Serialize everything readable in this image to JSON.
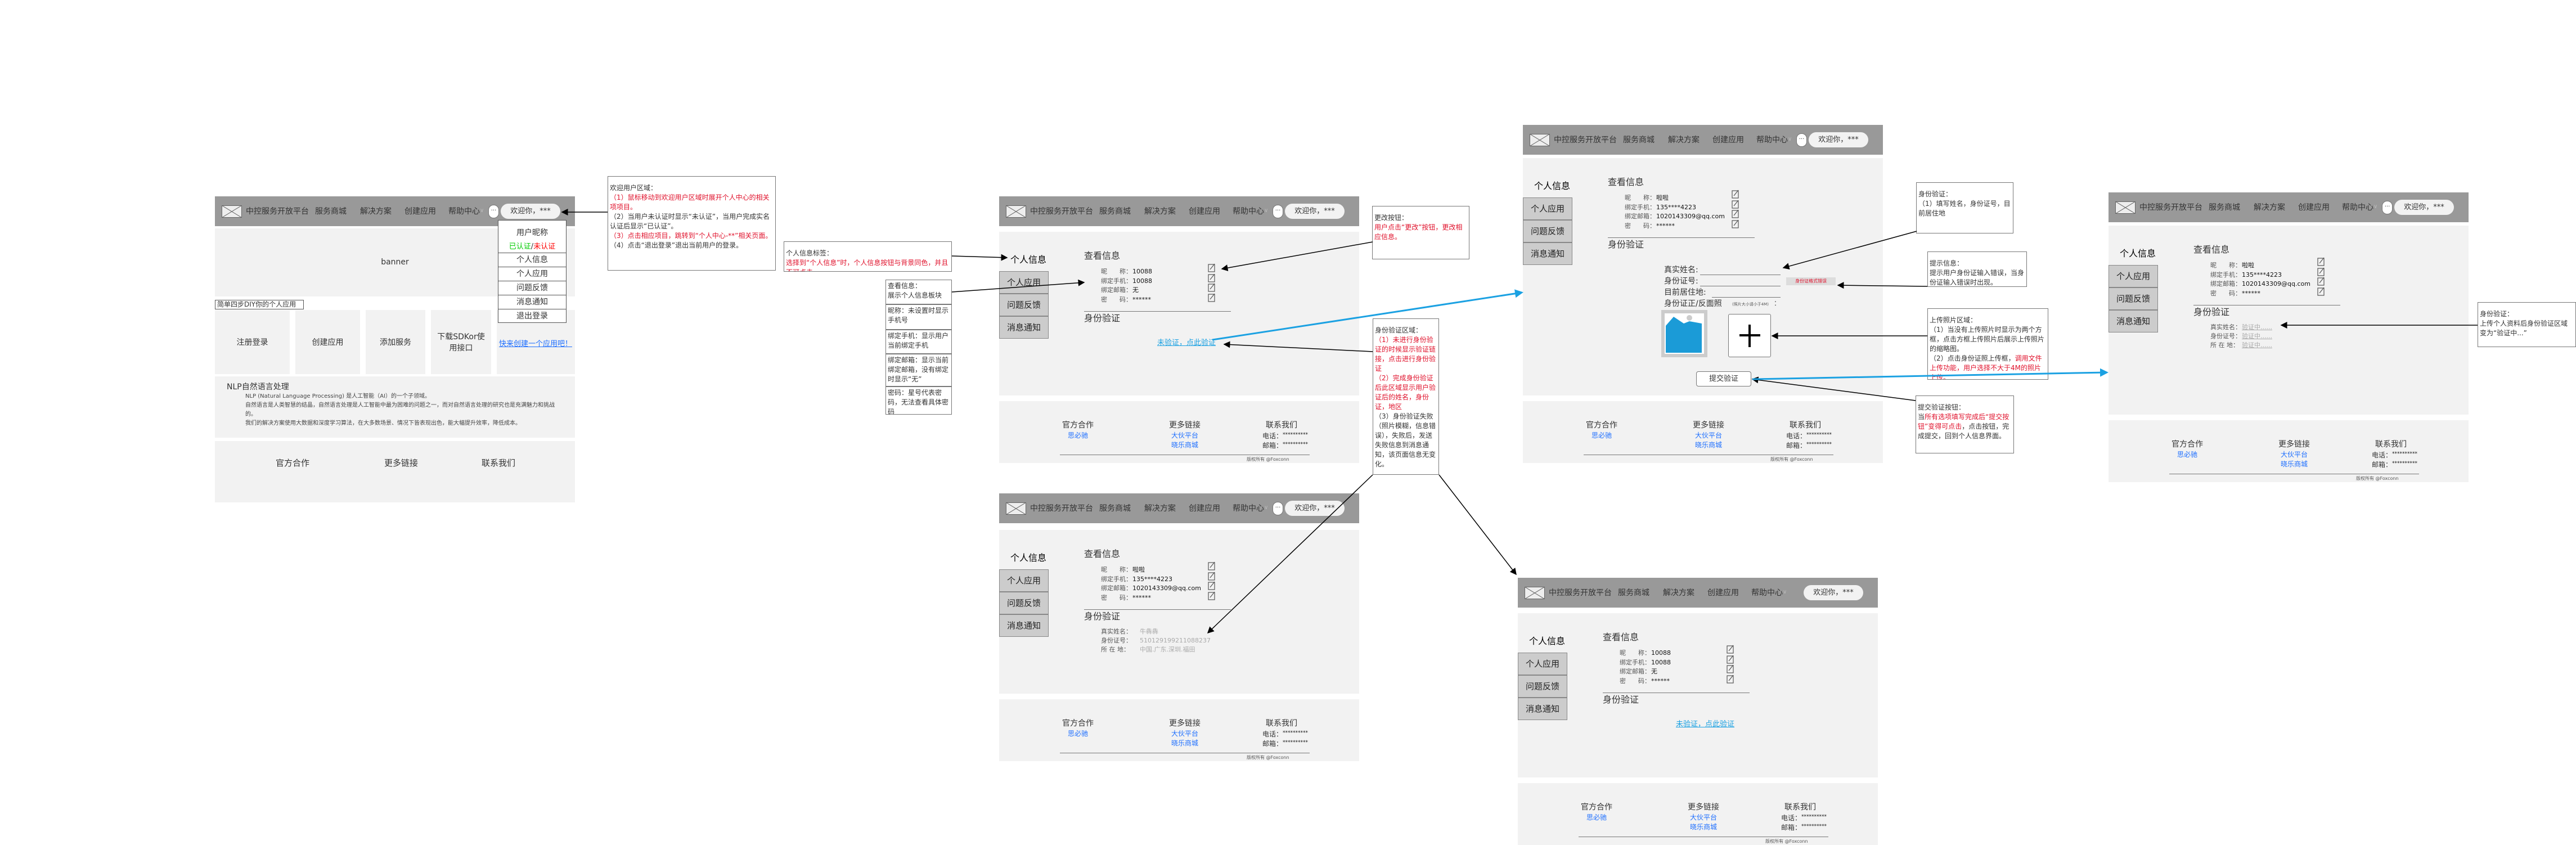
{
  "header": {
    "title": "中控服务开放平台",
    "nav": [
      "服务商城",
      "解决方案",
      "创建应用",
      "帮助中心"
    ],
    "welcome": "欢迎你，***"
  },
  "home": {
    "banner": "banner",
    "dropdown": {
      "nickname": "用户昵称",
      "verified": "已认证",
      "sep": "/",
      "unverified": "未认证",
      "items": [
        "个人信息",
        "个人应用",
        "问题反馈",
        "消息通知",
        "退出登录"
      ]
    },
    "steps_label": "简单四步DIY你的个人应用",
    "steps": [
      "注册登录",
      "创建应用",
      "添加服务",
      "下载SDKor使用接口"
    ],
    "cta": "快来创建一个应用吧！",
    "nlp": {
      "title": "NLP自然语言处理",
      "lines": [
        "NLP (Natural Language Processing) 是人工智能（AI）的一个子领域。",
        "自然语言是人类智慧的结晶，自然语言处理是人工智能中最为困难的问题之一，而对自然语言处理的研究也是充满魅力和挑战的。",
        "我们的解决方案使用大数据和深度学习算法，在大多数场景、情况下皆表现出色，能大幅提升效率，降低成本。"
      ]
    }
  },
  "footer": {
    "cooperation": {
      "title": "官方合作",
      "links": [
        "思必驰"
      ]
    },
    "more": {
      "title": "更多链接",
      "links": [
        "大伙平台",
        "晓乐商城"
      ]
    },
    "contact": {
      "title": "联系我们",
      "phone_label": "电话：",
      "phone": "**********",
      "email_label": "邮箱：",
      "email": "**********"
    },
    "copyright": "版权所有 @Foxconn"
  },
  "profile": {
    "active_tab": "个人信息",
    "tabs": [
      "个人应用",
      "问题反馈",
      "消息通知"
    ],
    "view_title": "查看信息",
    "field_labels": [
      "昵　　称：",
      "绑定手机：",
      "绑定邮箱：",
      "密　　码："
    ],
    "identity_title": "身份验证"
  },
  "screens": {
    "unverified": {
      "values": [
        "10088",
        "10088",
        "无",
        "******"
      ],
      "verify_link": "未验证，点此验证"
    },
    "verified": {
      "values": [
        "啦啦",
        "135****4223",
        "1020143309@qq.com",
        "******"
      ],
      "id_labels": [
        "真实姓名：",
        "身份证号：",
        "所 在 地："
      ],
      "id_values": [
        "牛犇犇",
        "510129199211088237",
        "中国.广东.深圳.福田"
      ]
    },
    "verifying": {
      "values": [
        "啦啦",
        "135****4223",
        "1020143309@qq.com",
        "******"
      ],
      "id_labels": [
        "真实姓名：",
        "身份证号：",
        "所 在 地："
      ],
      "id_values": [
        "验证中......",
        "验证中......",
        "验证中......"
      ]
    },
    "form": {
      "values": [
        "啦啦",
        "135****4223",
        "1020143309@qq.com",
        "******"
      ],
      "labels": [
        "真实姓名:",
        "身份证号:",
        "目前居住地:",
        "身份证正/反面照"
      ],
      "photo_hint": "(照片大小请小于4M)",
      "photo_colon": "：",
      "error": "身份证格式错误",
      "submit": "提交验证"
    }
  },
  "colors": {
    "header": "#999999",
    "panel": "#f2f2f2",
    "tab": "#cccccc",
    "link": "#1ba1e2",
    "note_red": "#e0112b",
    "flow_blue": "#1ba1e2",
    "verified": "#00cc00",
    "unverified": "#ff0000"
  },
  "annotations": [
    {
      "paras": [
        [
          {
            "t": "欢迎用户区域："
          }
        ],
        [
          {
            "t": "（1）鼠标移动到欢迎用户区域时展开个人中心的相关项项目。",
            "red": true
          }
        ],
        [
          {
            "t": "（2）当用户未认证时显示“未认证”，当用户完成实名认证后显示“已认证”。"
          }
        ],
        [
          {
            "t": "（3）点击相应项目，跳转到“个人中心-**”相关页面。",
            "red": true
          }
        ],
        [
          {
            "t": "（4）点击“退出登录”退出当前用户的登录。"
          }
        ]
      ]
    },
    {
      "paras": [
        [
          {
            "t": "个人信息标签："
          }
        ],
        [
          {
            "t": "选择到“个人信息”时，个人信息按钮与背景同色，并且不可点击",
            "red": true
          }
        ]
      ]
    },
    {
      "paras": [
        [
          {
            "t": "查看信息："
          }
        ],
        [
          {
            "t": "展示个人信息板块"
          }
        ]
      ]
    },
    {
      "paras": [
        [
          {
            "t": "昵称：未设置时显示手机号"
          }
        ]
      ]
    },
    {
      "paras": [
        [
          {
            "t": "绑定手机：显示用户当前绑定手机"
          }
        ]
      ]
    },
    {
      "paras": [
        [
          {
            "t": "绑定邮箱：显示当前绑定邮箱，没有绑定时显示“无”"
          }
        ]
      ]
    },
    {
      "paras": [
        [
          {
            "t": "密码：星号代表密码，无法查看具体密码"
          }
        ]
      ]
    },
    {
      "paras": [
        [
          {
            "t": "更改按钮："
          }
        ],
        [
          {
            "t": "用户点击“更改”按钮，更改相应信息。",
            "red": true
          }
        ]
      ]
    },
    {
      "paras": [
        [
          {
            "t": "身份验证区域："
          }
        ],
        [
          {
            "t": "（1）未进行身份验证的时候显示验证链接，点击进行身份验证",
            "red": true
          }
        ],
        [
          {
            "t": "（2）完成身份验证后此区域显示用户验证后的姓名，身份证，地区",
            "red": true
          }
        ],
        [
          {
            "t": "（3）身份验证失败（照片模糊，信息错误），失败后，发送失败信息到消息通知，该页面信息无变化。"
          }
        ]
      ]
    },
    {
      "paras": [
        [
          {
            "t": "身份验证："
          }
        ],
        [
          {
            "t": "（1）填写姓名，身份证号，目前居住地"
          }
        ]
      ]
    },
    {
      "paras": [
        [
          {
            "t": "提示信息："
          }
        ],
        [
          {
            "t": "提示用户身份证输入错误，当身份证输入错误时出现。"
          }
        ]
      ]
    },
    {
      "paras": [
        [
          {
            "t": "上传照片区域："
          }
        ],
        [
          {
            "t": "（1）当没有上传照片时显示为两个方框，点击方框上传照片后展示上传照片的缩略图。"
          }
        ],
        [
          {
            "t": "（2）点击身份证照上传框，"
          },
          {
            "t": "调用文件上传功能，用户选择不大于4M的照片上传。",
            "red": true
          }
        ]
      ]
    },
    {
      "paras": [
        [
          {
            "t": "提交验证按钮："
          }
        ],
        [
          {
            "t": "当"
          },
          {
            "t": "所有选项填写完成后“提交按钮”变得可点击",
            "red": true
          },
          {
            "t": "，点击按钮，完成提交，回到个人信息界面。"
          }
        ]
      ]
    },
    {
      "paras": [
        [
          {
            "t": "身份验证："
          }
        ],
        [
          {
            "t": "上传个人资料后身份验证区域变为“验证中...”"
          }
        ]
      ]
    }
  ]
}
